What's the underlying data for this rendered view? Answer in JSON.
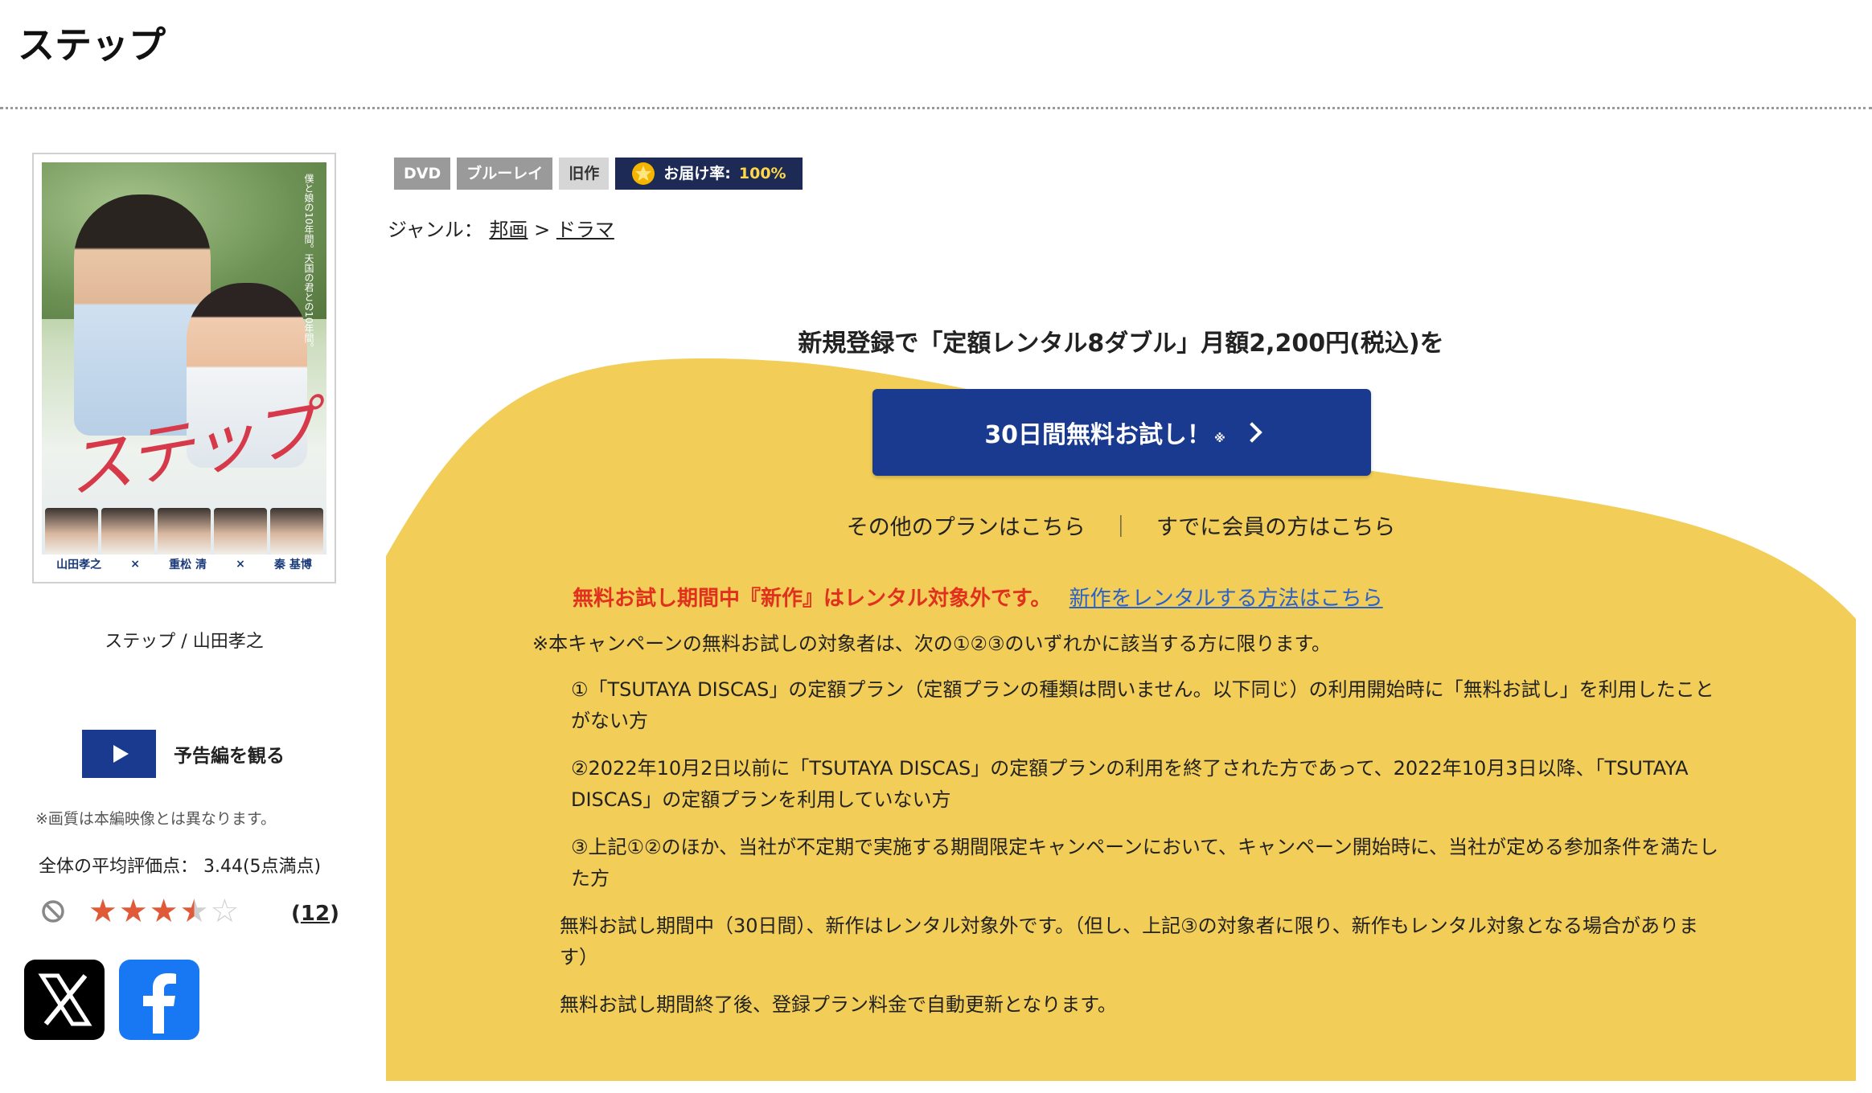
{
  "page": {
    "title": "ステップ"
  },
  "poster": {
    "caption": "ステップ / 山田孝之",
    "art_title": "ステップ",
    "art_tagline": "僕と娘の10年間。天国の君との10年間。",
    "credits": [
      "山田孝之",
      "×",
      "重松 清",
      "×",
      "秦 基博"
    ]
  },
  "trailer": {
    "label": "予告編を観る"
  },
  "quality_note": "※画質は本編映像とは異なります。",
  "rating": {
    "avg_text": "全体の平均評価点： 3.44(5点満点)",
    "value": 3.44,
    "max": 5,
    "review_count": "12"
  },
  "badges": {
    "dvd": "DVD",
    "bluray": "ブルーレイ",
    "old": "旧作",
    "delivery_label": "お届け率:",
    "delivery_pct": "100%"
  },
  "genre": {
    "label": "ジャンル：",
    "items": [
      "邦画",
      "ドラマ"
    ],
    "separator": ">"
  },
  "promo": {
    "headline": "新規登録で「定額レンタル8ダブル」月額2,200円(税込)を",
    "cta_label": "30日間無料お試し！",
    "cta_mark": "※",
    "other_plans": "その他のプランはこちら",
    "divider": "｜",
    "member_link": "すでに会員の方はこちら",
    "warning": "無料お試し期間中『新作』はレンタル対象外です。",
    "warning_link": "新作をレンタルする方法はこちら",
    "intro": "※本キャンペーンの無料お試しの対象者は、次の①②③のいずれかに該当する方に限ります。",
    "conditions": [
      "①「TSUTAYA DISCAS」の定額プラン（定額プランの種類は問いません。以下同じ）の利用開始時に「無料お試し」を利用したことがない方",
      "②2022年10月2日以前に「TSUTAYA DISCAS」の定額プランの利用を終了された方であって、2022年10月3日以降、「TSUTAYA DISCAS」の定額プランを利用していない方",
      "③上記①②のほか、当社が不定期で実施する期間限定キャンペーンにおいて、キャンペーン開始時に、当社が定める参加条件を満たした方"
    ],
    "note1": "無料お試し期間中（30日間）、新作はレンタル対象外です。（但し、上記③の対象者に限り、新作もレンタル対象となる場合があります）",
    "note2": "無料お試し期間終了後、登録プラン料金で自動更新となります。"
  },
  "colors": {
    "navy": "#1a3a8f",
    "yellow_bg": "#f2cd57",
    "warning_red": "#e0301e",
    "link_blue": "#2a62c9",
    "star": "#e05a3a"
  },
  "icons": {
    "play": "play-icon",
    "no": "no-sign-icon",
    "star_badge": "star-badge-icon",
    "chevron": "chevron-right-icon",
    "x": "x-logo-icon",
    "facebook": "facebook-logo-icon"
  }
}
